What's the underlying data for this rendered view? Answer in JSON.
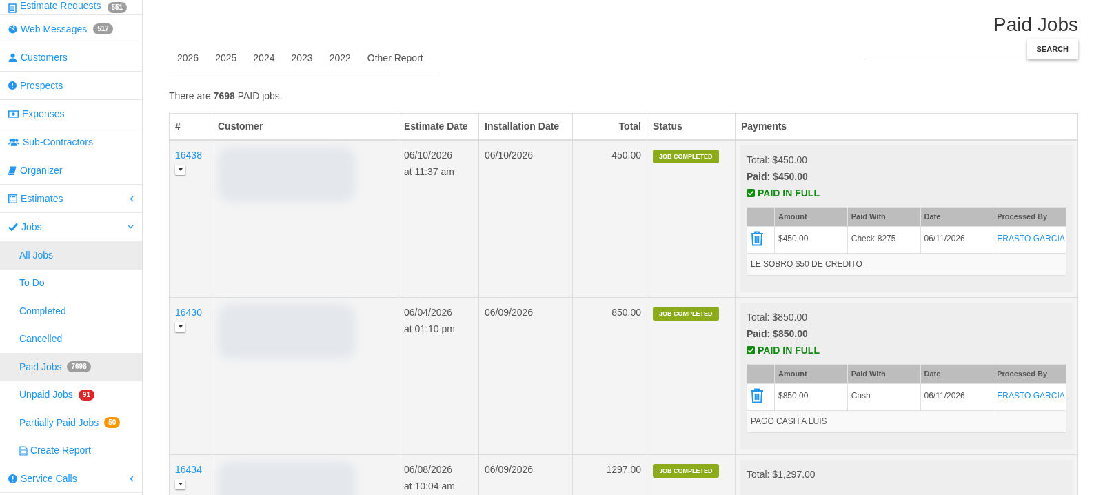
{
  "sidebar": {
    "items": [
      {
        "label": "Estimate Requests",
        "badge": {
          "text": "551",
          "color": "#9e9e9e"
        }
      },
      {
        "label": "Web Messages",
        "badge": {
          "text": "517",
          "color": "#9e9e9e"
        }
      },
      {
        "label": "Customers"
      },
      {
        "label": "Prospects"
      },
      {
        "label": "Expenses"
      },
      {
        "label": "Sub-Contractors"
      },
      {
        "label": "Organizer"
      },
      {
        "label": "Estimates",
        "expanded": false
      },
      {
        "label": "Jobs",
        "expanded": true,
        "children": [
          {
            "label": "All Jobs",
            "selected": true
          },
          {
            "label": "To Do",
            "selected": false
          },
          {
            "label": "Completed",
            "selected": false
          },
          {
            "label": "Cancelled",
            "selected": false
          },
          {
            "label": "Paid Jobs",
            "selected": true,
            "badge": {
              "text": "7698",
              "color": "#9e9e9e"
            }
          },
          {
            "label": "Unpaid Jobs",
            "selected": false,
            "badge": {
              "text": "91",
              "color": "#e0262b"
            }
          },
          {
            "label": "Partially Paid Jobs",
            "selected": false,
            "badge": {
              "text": "50",
              "color": "#ff9800"
            }
          },
          {
            "label": "Create Report",
            "selected": false
          }
        ]
      },
      {
        "label": "Service Calls",
        "expanded": false
      }
    ]
  },
  "page": {
    "title": "Paid Jobs",
    "tabs": [
      "2026",
      "2025",
      "2024",
      "2023",
      "2022",
      "Other Report"
    ],
    "search_button": "SEARCH",
    "summary": "There are **7698** PAID jobs."
  },
  "table": {
    "columns": [
      "#",
      "Customer",
      "Estimate Date",
      "Installation Date",
      "Total",
      "Status",
      "Payments"
    ],
    "rows": [
      {
        "number": "16438",
        "estimate_date": "06/10/2026",
        "estimate_time": "at 11:37 am",
        "installation_date": "06/10/2026",
        "total": "450.00",
        "status": "JOB COMPLETED",
        "payments": {
          "total": "Total: $450.00",
          "paid": "Paid: $450.00",
          "paid_in_full": true,
          "paid_label": "PAID IN FULL",
          "columns": [
            "Amount",
            "Paid With",
            "Date",
            "Processed By"
          ],
          "entries": [
            {
              "amount": "$450.00",
              "paid_with": "Check-8275",
              "date": "06/11/2026",
              "processed_by": "ERASTO GARCIA"
            }
          ],
          "note": "LE SOBRO $50 DE CREDITO"
        }
      },
      {
        "number": "16430",
        "estimate_date": "06/04/2026",
        "estimate_time": "at 01:10 pm",
        "installation_date": "06/09/2026",
        "total": "850.00",
        "status": "JOB COMPLETED",
        "payments": {
          "total": "Total: $850.00",
          "paid": "Paid: $850.00",
          "paid_in_full": true,
          "paid_label": "PAID IN FULL",
          "columns": [
            "Amount",
            "Paid With",
            "Date",
            "Processed By"
          ],
          "entries": [
            {
              "amount": "$850.00",
              "paid_with": "Cash",
              "date": "06/11/2026",
              "processed_by": "ERASTO GARCIA"
            }
          ],
          "note": "PAGO CASH A LUIS"
        }
      },
      {
        "number": "16434",
        "estimate_date": "06/08/2026",
        "estimate_time": "at 10:04 am",
        "installation_date": "06/09/2026",
        "total": "1297.00",
        "status": "JOB COMPLETED",
        "payments": {
          "total": "Total: $1,297.00"
        }
      }
    ]
  }
}
